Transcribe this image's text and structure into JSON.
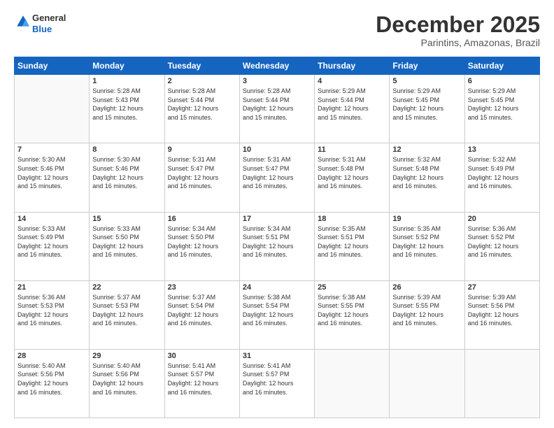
{
  "header": {
    "logo_general": "General",
    "logo_blue": "Blue",
    "month_title": "December 2025",
    "subtitle": "Parintins, Amazonas, Brazil"
  },
  "days_of_week": [
    "Sunday",
    "Monday",
    "Tuesday",
    "Wednesday",
    "Thursday",
    "Friday",
    "Saturday"
  ],
  "weeks": [
    [
      {
        "day": "",
        "info": ""
      },
      {
        "day": "1",
        "info": "Sunrise: 5:28 AM\nSunset: 5:43 PM\nDaylight: 12 hours\nand 15 minutes."
      },
      {
        "day": "2",
        "info": "Sunrise: 5:28 AM\nSunset: 5:44 PM\nDaylight: 12 hours\nand 15 minutes."
      },
      {
        "day": "3",
        "info": "Sunrise: 5:28 AM\nSunset: 5:44 PM\nDaylight: 12 hours\nand 15 minutes."
      },
      {
        "day": "4",
        "info": "Sunrise: 5:29 AM\nSunset: 5:44 PM\nDaylight: 12 hours\nand 15 minutes."
      },
      {
        "day": "5",
        "info": "Sunrise: 5:29 AM\nSunset: 5:45 PM\nDaylight: 12 hours\nand 15 minutes."
      },
      {
        "day": "6",
        "info": "Sunrise: 5:29 AM\nSunset: 5:45 PM\nDaylight: 12 hours\nand 15 minutes."
      }
    ],
    [
      {
        "day": "7",
        "info": "Sunrise: 5:30 AM\nSunset: 5:46 PM\nDaylight: 12 hours\nand 15 minutes."
      },
      {
        "day": "8",
        "info": "Sunrise: 5:30 AM\nSunset: 5:46 PM\nDaylight: 12 hours\nand 16 minutes."
      },
      {
        "day": "9",
        "info": "Sunrise: 5:31 AM\nSunset: 5:47 PM\nDaylight: 12 hours\nand 16 minutes."
      },
      {
        "day": "10",
        "info": "Sunrise: 5:31 AM\nSunset: 5:47 PM\nDaylight: 12 hours\nand 16 minutes."
      },
      {
        "day": "11",
        "info": "Sunrise: 5:31 AM\nSunset: 5:48 PM\nDaylight: 12 hours\nand 16 minutes."
      },
      {
        "day": "12",
        "info": "Sunrise: 5:32 AM\nSunset: 5:48 PM\nDaylight: 12 hours\nand 16 minutes."
      },
      {
        "day": "13",
        "info": "Sunrise: 5:32 AM\nSunset: 5:49 PM\nDaylight: 12 hours\nand 16 minutes."
      }
    ],
    [
      {
        "day": "14",
        "info": "Sunrise: 5:33 AM\nSunset: 5:49 PM\nDaylight: 12 hours\nand 16 minutes."
      },
      {
        "day": "15",
        "info": "Sunrise: 5:33 AM\nSunset: 5:50 PM\nDaylight: 12 hours\nand 16 minutes."
      },
      {
        "day": "16",
        "info": "Sunrise: 5:34 AM\nSunset: 5:50 PM\nDaylight: 12 hours\nand 16 minutes."
      },
      {
        "day": "17",
        "info": "Sunrise: 5:34 AM\nSunset: 5:51 PM\nDaylight: 12 hours\nand 16 minutes."
      },
      {
        "day": "18",
        "info": "Sunrise: 5:35 AM\nSunset: 5:51 PM\nDaylight: 12 hours\nand 16 minutes."
      },
      {
        "day": "19",
        "info": "Sunrise: 5:35 AM\nSunset: 5:52 PM\nDaylight: 12 hours\nand 16 minutes."
      },
      {
        "day": "20",
        "info": "Sunrise: 5:36 AM\nSunset: 5:52 PM\nDaylight: 12 hours\nand 16 minutes."
      }
    ],
    [
      {
        "day": "21",
        "info": "Sunrise: 5:36 AM\nSunset: 5:53 PM\nDaylight: 12 hours\nand 16 minutes."
      },
      {
        "day": "22",
        "info": "Sunrise: 5:37 AM\nSunset: 5:53 PM\nDaylight: 12 hours\nand 16 minutes."
      },
      {
        "day": "23",
        "info": "Sunrise: 5:37 AM\nSunset: 5:54 PM\nDaylight: 12 hours\nand 16 minutes."
      },
      {
        "day": "24",
        "info": "Sunrise: 5:38 AM\nSunset: 5:54 PM\nDaylight: 12 hours\nand 16 minutes."
      },
      {
        "day": "25",
        "info": "Sunrise: 5:38 AM\nSunset: 5:55 PM\nDaylight: 12 hours\nand 16 minutes."
      },
      {
        "day": "26",
        "info": "Sunrise: 5:39 AM\nSunset: 5:55 PM\nDaylight: 12 hours\nand 16 minutes."
      },
      {
        "day": "27",
        "info": "Sunrise: 5:39 AM\nSunset: 5:56 PM\nDaylight: 12 hours\nand 16 minutes."
      }
    ],
    [
      {
        "day": "28",
        "info": "Sunrise: 5:40 AM\nSunset: 5:56 PM\nDaylight: 12 hours\nand 16 minutes."
      },
      {
        "day": "29",
        "info": "Sunrise: 5:40 AM\nSunset: 5:56 PM\nDaylight: 12 hours\nand 16 minutes."
      },
      {
        "day": "30",
        "info": "Sunrise: 5:41 AM\nSunset: 5:57 PM\nDaylight: 12 hours\nand 16 minutes."
      },
      {
        "day": "31",
        "info": "Sunrise: 5:41 AM\nSunset: 5:57 PM\nDaylight: 12 hours\nand 16 minutes."
      },
      {
        "day": "",
        "info": ""
      },
      {
        "day": "",
        "info": ""
      },
      {
        "day": "",
        "info": ""
      }
    ]
  ]
}
